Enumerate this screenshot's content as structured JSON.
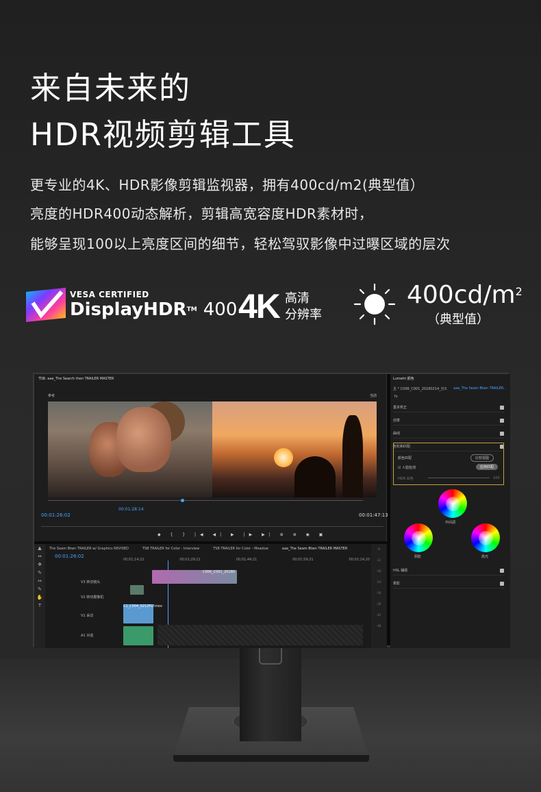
{
  "headline": {
    "line1": "来自未来的",
    "line2": "HDR视频剪辑工具"
  },
  "description": {
    "line1": "更专业的4K、HDR影像剪辑监视器，拥有400cd/m2(典型值）",
    "line2": "亮度的HDR400动态解析，剪辑高宽容度HDR素材时，",
    "line3": "能够呈现100以上亮度区间的细节，轻松驾驭影像中过曝区域的层次"
  },
  "features": {
    "vesa": {
      "small": "VESA CERTIFIED",
      "big": "DisplayHDR",
      "tm": "TM",
      "num": "400"
    },
    "resolution": {
      "big": "4K",
      "sub1": "高清",
      "sub2": "分辨率"
    },
    "brightness": {
      "value": "400cd/m",
      "sup": "2",
      "sub": "（典型值）"
    }
  },
  "premiere": {
    "program_title": "节目: aaa_The Search then TRAILER MASTER",
    "reference": "参考",
    "current": "当前",
    "timecode_left": "00:01:26:02",
    "timecode_center": "00:01:28:14",
    "timecode_right": "00:01:47:13",
    "timeline_timecode": "00:01:26:02",
    "tabs": [
      "The Seam Btwn TRAILER w/ Graphics REVISED",
      "TSB TRAILER for Color - Interview",
      "TSB TRAILER for Color - Meadow",
      "aaa_The Seam Btwn TRAILER MASTER"
    ],
    "ruler": [
      "00;01;14;22",
      "00;01;29;21",
      "00;01;44;21",
      "00;01;59;21",
      "00;02;14;20"
    ],
    "tracks": [
      "V3 转切镜头",
      "V2 转切摄像机",
      "V1 采访",
      "A1 对话"
    ],
    "clips": [
      "C006_C001_20180",
      "C1_C004_0212FLY.mov"
    ],
    "lumetri": {
      "title": "Lumetri 颜色",
      "source": "主 * C006_C001_20180214_分3...",
      "sequence": "aaa_The Seam Btwn TRAILER...",
      "fx": "fx",
      "sections": [
        "基本校正",
        "创意",
        "曲线",
        "色轮和匹配"
      ],
      "match": {
        "label": "颜色匹配",
        "compare": "比较视图",
        "face": "人脸检测",
        "apply": "应用匹配",
        "hdr": "HDR 白色",
        "hdr_value": "100"
      },
      "wheels": [
        "中间调",
        "阴影",
        "高光"
      ],
      "bottom_sections": [
        "HSL 辅助",
        "晕影"
      ]
    }
  }
}
